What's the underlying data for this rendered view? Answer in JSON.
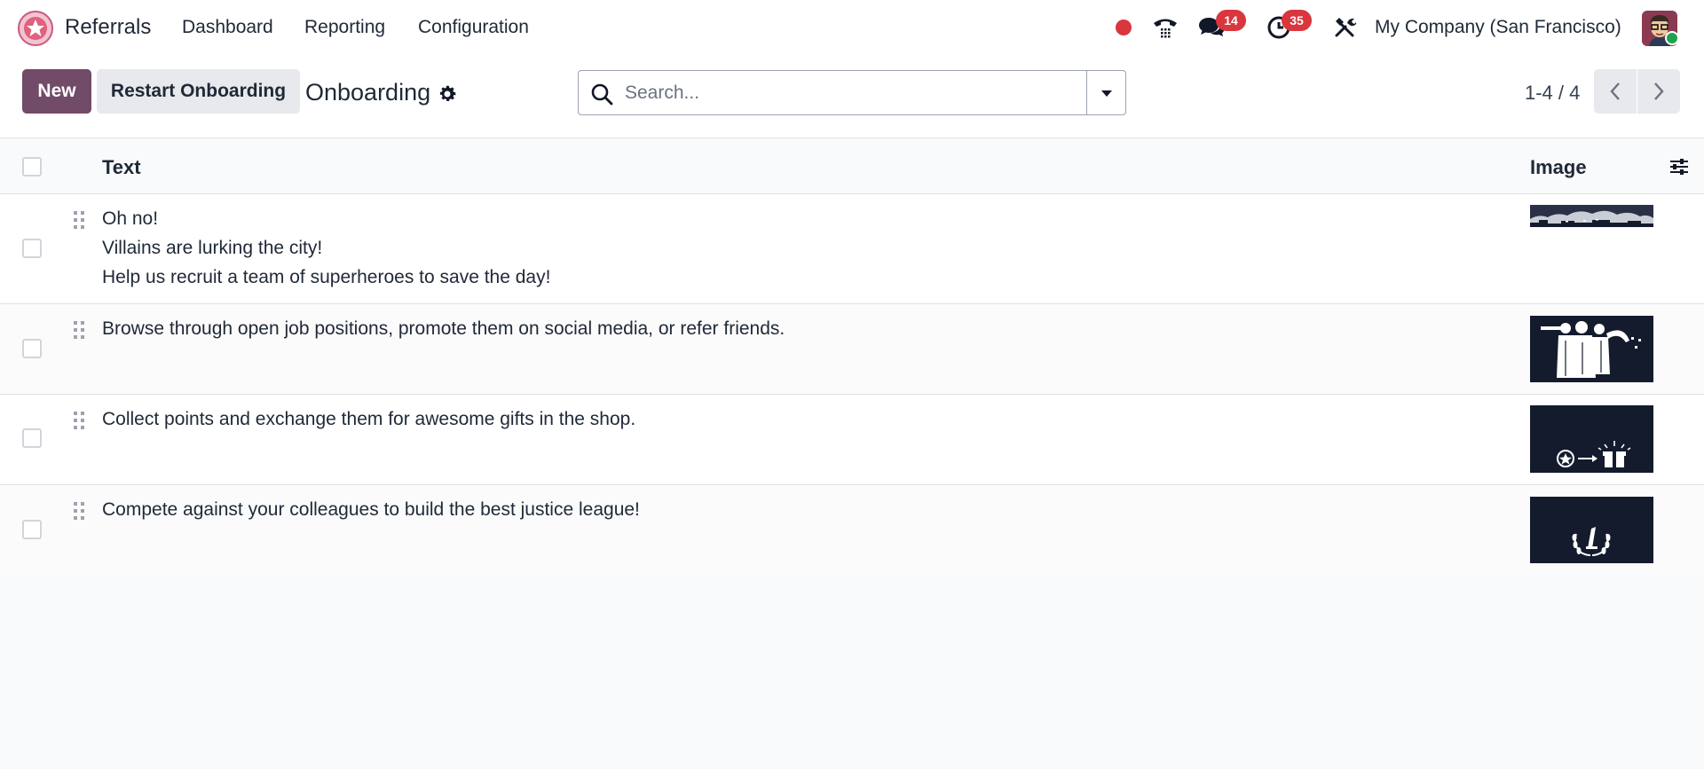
{
  "navbar": {
    "app_name": "Referrals",
    "menu": [
      "Dashboard",
      "Reporting",
      "Configuration"
    ],
    "messages_count": "14",
    "activities_count": "35",
    "company": "My Company (San Francisco)"
  },
  "control": {
    "new_label": "New",
    "restart_label": "Restart Onboarding",
    "title": "Onboarding",
    "search_placeholder": "Search...",
    "pager": "1-4 / 4"
  },
  "table": {
    "columns": [
      "Text",
      "Image"
    ],
    "rows": [
      {
        "lines": [
          "Oh no!",
          "Villains are lurking the city!",
          "Help us recruit a team of superheroes to save the day!"
        ],
        "image": "city-skyline-image"
      },
      {
        "lines": [
          "Browse through open job positions, promote them on social media, or refer friends."
        ],
        "image": "superheroes-image"
      },
      {
        "lines": [
          "Collect points and exchange them for awesome gifts in the shop."
        ],
        "image": "points-to-gift-image"
      },
      {
        "lines": [
          "Compete against your colleagues to build the best justice league!"
        ],
        "image": "first-place-laurel-image"
      }
    ]
  },
  "colors": {
    "primary": "#714b67",
    "badge": "#d9363e",
    "status_online": "#1ea34a"
  }
}
